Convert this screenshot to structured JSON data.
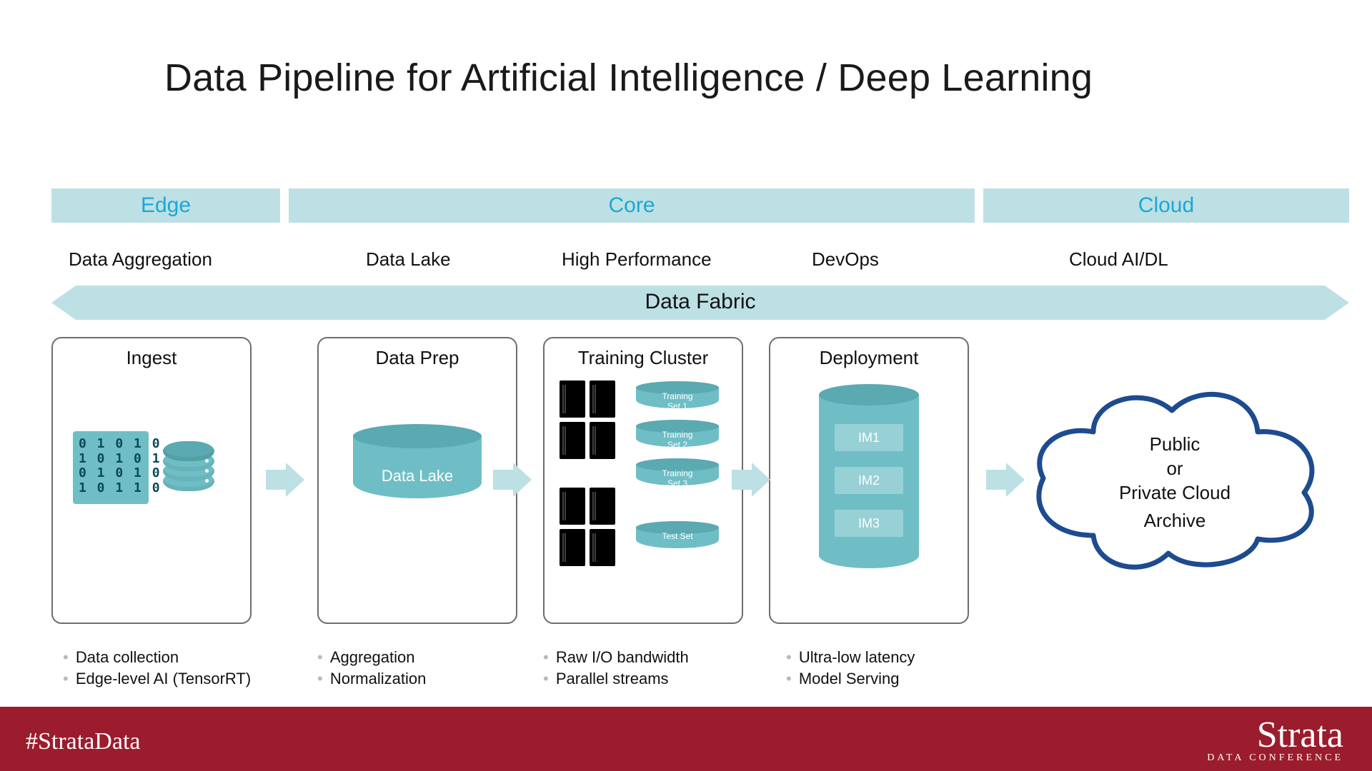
{
  "title": "Data Pipeline for Artificial Intelligence / Deep Learning",
  "bands": {
    "edge": "Edge",
    "core": "Core",
    "cloud": "Cloud"
  },
  "sublabels": {
    "edge": "Data Aggregation",
    "lake": "Data Lake",
    "hp": "High Performance",
    "devops": "DevOps",
    "cloud": "Cloud AI/DL"
  },
  "fabric": "Data Fabric",
  "boxes": {
    "ingest": "Ingest",
    "prep": "Data Prep",
    "train": "Training Cluster",
    "deploy": "Deployment"
  },
  "dataLakeLabel": "Data Lake",
  "binary": "0 1 0 1 0\n1 0 1 0 1\n0 1 0 1 0\n1 0 1 1 0",
  "trainSets": {
    "s1": "Training\nSet 1",
    "s2": "Training\nSet 2",
    "s3": "Training\nSet 3",
    "test": "Test Set"
  },
  "deployIM": {
    "im1": "IM1",
    "im2": "IM2",
    "im3": "IM3"
  },
  "cloudText": {
    "l1": "Public",
    "l2": "or",
    "l3": "Private Cloud",
    "l4": "Archive"
  },
  "bullets": {
    "ingest": [
      "Data collection",
      "Edge-level AI (TensorRT)"
    ],
    "prep": [
      "Aggregation",
      "Normalization"
    ],
    "train": [
      "Raw I/O bandwidth",
      "Parallel streams"
    ],
    "deploy": [
      "Ultra-low latency",
      "Model Serving"
    ]
  },
  "footer": {
    "hashtag": "#StrataData",
    "brand": "Strata",
    "brandSub": "DATA CONFERENCE"
  }
}
